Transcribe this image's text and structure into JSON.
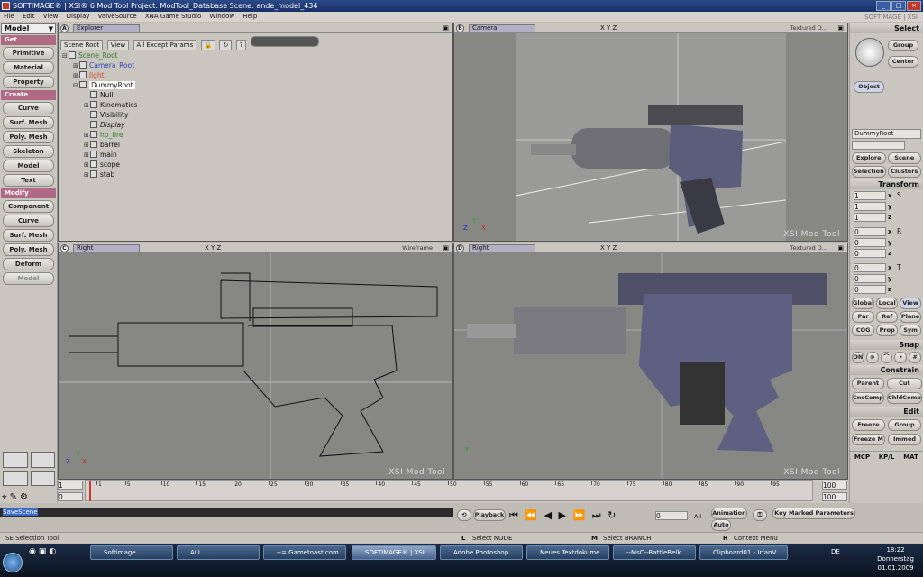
{
  "window": {
    "title": "SOFTIMAGE® | XSI® 6 Mod Tool Project: ModTool_Database    Scene: ande_model_434",
    "brand": "SOFTIMAGE | XSI"
  },
  "menu": [
    "File",
    "Edit",
    "View",
    "Display",
    "ValveSource",
    "XNA Game Studio",
    "Window",
    "Help"
  ],
  "left_panel": {
    "mode": "Model",
    "sections": [
      {
        "label": "Get",
        "buttons": [
          "Primitive",
          "Material",
          "Property"
        ]
      },
      {
        "label": "Create",
        "buttons": [
          "Curve",
          "Surf. Mesh",
          "Poly. Mesh",
          "Skeleton",
          "Model",
          "Text"
        ]
      },
      {
        "label": "Modify",
        "buttons": [
          "Component",
          "Curve",
          "Surf. Mesh",
          "Poly. Mesh",
          "Deform",
          "Model"
        ]
      }
    ]
  },
  "explorer": {
    "letter": "A",
    "mode": "Explorer",
    "toolbar": [
      "Scene Root",
      "View",
      "All Except Params"
    ],
    "tree": [
      {
        "label": "Scene_Root",
        "color": "#2d7a2d",
        "indent": 0,
        "expander": "⊟"
      },
      {
        "label": "Camera_Root",
        "color": "#2d46b8",
        "indent": 1,
        "expander": "⊞"
      },
      {
        "label": "light",
        "color": "#d7452c",
        "indent": 1,
        "expander": "⊞"
      },
      {
        "label": "DummyRoot",
        "color": "#111111",
        "indent": 1,
        "expander": "⊟",
        "selected": true
      },
      {
        "label": "Null",
        "color": "#111111",
        "indent": 2,
        "expander": ""
      },
      {
        "label": "Kinematics",
        "color": "#111111",
        "indent": 2,
        "expander": "⊞"
      },
      {
        "label": "Visibility",
        "color": "#111111",
        "indent": 2,
        "expander": ""
      },
      {
        "label": "Display",
        "color": "#111111",
        "indent": 2,
        "expander": "",
        "italic": true
      },
      {
        "label": "hp_fire",
        "color": "#2d7a2d",
        "indent": 2,
        "expander": "⊞"
      },
      {
        "label": "barrel",
        "color": "#111111",
        "indent": 2,
        "expander": "⊞"
      },
      {
        "label": "main",
        "color": "#111111",
        "indent": 2,
        "expander": "⊞"
      },
      {
        "label": "scope",
        "color": "#111111",
        "indent": 2,
        "expander": "⊞"
      },
      {
        "label": "stab",
        "color": "#111111",
        "indent": 2,
        "expander": "⊞"
      }
    ]
  },
  "viewports": {
    "B": {
      "letter": "B",
      "mode": "Camera",
      "axes": "X Y Z",
      "display": "Textured D..."
    },
    "C": {
      "letter": "C",
      "mode": "Right",
      "axes": "X Y Z",
      "display": "Wireframe"
    },
    "D": {
      "letter": "D",
      "mode": "Right",
      "axes": "X Y Z",
      "display": "Textured D..."
    },
    "watermark": "XSI Mod Tool"
  },
  "right_panel": {
    "header": "Select",
    "select_buttons": [
      "Group",
      "Center"
    ],
    "object_button": "Object",
    "object_name": "DummyRoot",
    "explore_buttons": [
      "Explore",
      "Scene",
      "Selection",
      "Clusters"
    ],
    "transform_header": "Transform",
    "scale_values": [
      "1",
      "1",
      "1"
    ],
    "rotate_values": [
      "0",
      "0",
      "0"
    ],
    "translate_values": [
      "0",
      "0",
      "0"
    ],
    "axis_labels": [
      "x",
      "y",
      "z"
    ],
    "ref_buttons": [
      "Global",
      "Local",
      "View",
      "Par",
      "Ref",
      "Plane",
      "COG",
      "Prop",
      "Sym"
    ],
    "snap_header": "Snap",
    "snap_on": "ON",
    "constrain_header": "Constrain",
    "constrain_buttons": [
      "Parent",
      "Cut",
      "CnsComp",
      "ChldComp"
    ],
    "edit_header": "Edit",
    "edit_buttons": [
      "Freeze",
      "Group",
      "Freeze M",
      "Immed"
    ],
    "tabs": [
      "MCP",
      "KP/L",
      "MAT"
    ]
  },
  "timeline": {
    "start": "1",
    "current": "0",
    "end": "100",
    "end2": "100",
    "ticks": [
      "1",
      "5",
      "10",
      "15",
      "20",
      "25",
      "30",
      "35",
      "40",
      "45",
      "50",
      "55",
      "60",
      "65",
      "70",
      "75",
      "80",
      "85",
      "90",
      "95"
    ],
    "frame_display": "100",
    "frame_input": "0",
    "all_label": "All"
  },
  "command": {
    "text": "SaveScene"
  },
  "playback": {
    "label": "Playback",
    "animation": "Animation",
    "auto": "Auto",
    "key_params": "Key Marked Parameters"
  },
  "help": {
    "tool": "SE Selection Tool",
    "left": "Select NODE",
    "middle": "Select BRANCH",
    "right": "Context Menu",
    "l_key": "L",
    "m_key": "M",
    "r_key": "R"
  },
  "taskbar": {
    "tasks": [
      "Softimage",
      "ALL",
      "--= Gametoast.com ...",
      "SOFTIMAGE® | XSI...",
      "Adobe Photoshop",
      "Neues Textdokume...",
      "--MsC--BattleBelk ...",
      "Clipboard01 - IrfanV..."
    ],
    "lang": "DE",
    "time": "18:22",
    "day": "Donnerstag",
    "date": "01.01.2009"
  }
}
